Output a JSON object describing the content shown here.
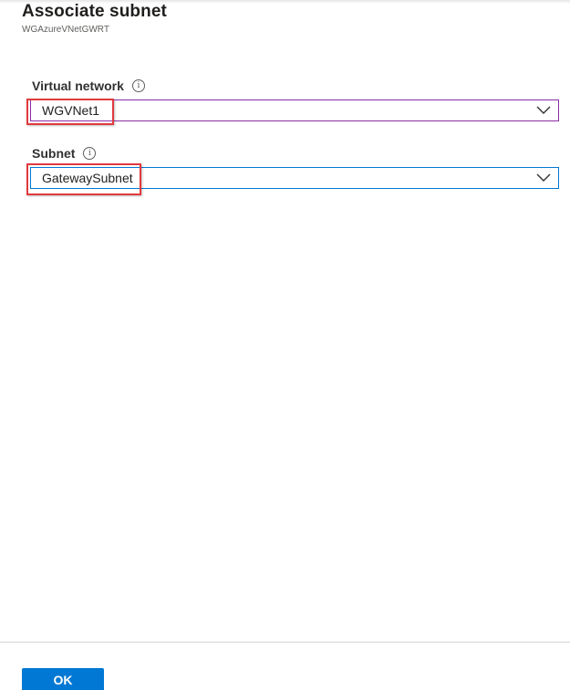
{
  "blade": {
    "title": "Associate subnet",
    "subtitle": "WGAzureVNetGWRT"
  },
  "form": {
    "virtual_network": {
      "label": "Virtual network",
      "info_icon": "info-icon",
      "selected_value": "WGVNet1"
    },
    "subnet": {
      "label": "Subnet",
      "info_icon": "info-icon",
      "selected_value": "GatewaySubnet"
    }
  },
  "footer": {
    "ok_label": "OK"
  },
  "colors": {
    "accent_blue": "#0078d4",
    "focus_purple": "#8a2da5",
    "highlight_red": "#e03a3e"
  }
}
